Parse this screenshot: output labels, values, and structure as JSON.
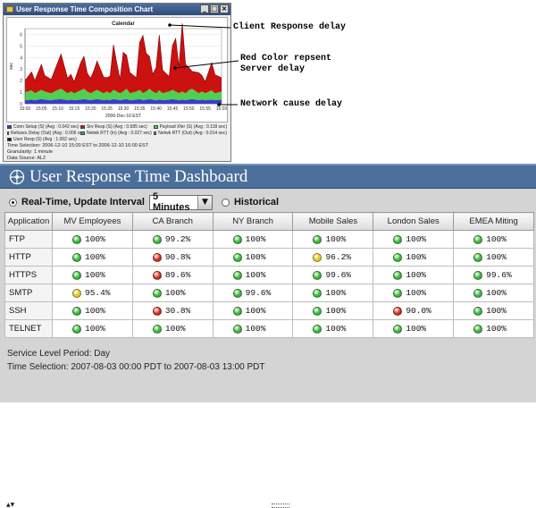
{
  "chart_window": {
    "title": "User Response Time Composition Chart",
    "controls": [
      "_",
      "□",
      "×"
    ],
    "legend": [
      {
        "label": "Conn Setup (S) (Avg : 0.042 sec)",
        "color": "#3a3ad6"
      },
      {
        "label": "Srv Resp (S) (Avg : 0.685 sec)",
        "color": "#cc1111"
      },
      {
        "label": "Payload Xfer (S) (Avg : 0.118 sec)",
        "color": "#4fd04f"
      },
      {
        "label": "Refuses Delay (Out) (Avg : 0.006 sec)",
        "color": "#8a5a2a"
      },
      {
        "label": "Netwk RTT (In) (Avg : 0.027 sec)",
        "color": "#2aa0a0"
      },
      {
        "label": "Netwk RTT (Out) (Avg : 0.014 sec)",
        "color": "#d050d0"
      },
      {
        "label": "User Resp (S) (Avg : 1.002 sec)",
        "color": "#222222"
      }
    ],
    "footer": [
      "Time Selection: 2006-12-10 15:00 EST to 2006-12-10 16:00 EST",
      "Granularity: 1 minute",
      "Data Source: AL2"
    ]
  },
  "chart_data": {
    "type": "area",
    "title": "Calendar",
    "xlabel": "2006-Dec-10 EST",
    "ylabel": "sec",
    "x_ticks": [
      "15:00",
      "15:05",
      "15:10",
      "15:15",
      "15:20",
      "15:25",
      "15:30",
      "15:35",
      "15:40",
      "15:45",
      "15:50",
      "15:55",
      "16:00"
    ],
    "y_ticks": [
      "0",
      "1",
      "2",
      "3",
      "4",
      "5",
      "6"
    ],
    "ylim": [
      0,
      6.5
    ],
    "x_minutes": [
      0,
      2,
      3,
      5,
      6,
      8,
      9,
      11,
      13,
      14,
      15,
      17,
      18,
      19,
      20,
      21,
      22,
      24,
      25,
      26,
      27,
      28,
      29,
      30,
      31,
      32,
      34,
      35,
      36,
      37,
      38,
      39,
      40,
      41,
      42,
      44,
      45,
      46,
      47,
      48,
      49,
      50,
      51,
      53,
      54,
      55,
      57,
      58,
      60
    ],
    "series": [
      {
        "name": "Netwk RTT",
        "color": "#3a3ad6",
        "values": [
          0.3,
          0.35,
          0.3,
          0.4,
          0.35,
          0.3,
          0.35,
          0.4,
          0.3,
          0.35,
          0.3,
          0.35,
          0.4,
          0.35,
          0.3,
          0.35,
          0.4,
          0.3,
          0.35,
          0.3,
          0.4,
          0.35,
          0.3,
          0.35,
          0.4,
          0.3,
          0.35,
          0.4,
          0.3,
          0.35,
          0.4,
          0.35,
          0.3,
          0.35,
          0.3,
          0.35,
          0.4,
          0.35,
          0.3,
          0.35,
          0.3,
          0.35,
          0.4,
          0.3,
          0.35,
          0.3,
          0.35,
          0.3,
          0.35
        ]
      },
      {
        "name": "Payload Xfer",
        "color": "#4fd04f",
        "values": [
          0.7,
          0.8,
          0.6,
          0.8,
          0.7,
          0.6,
          0.7,
          0.9,
          0.6,
          0.7,
          0.6,
          0.8,
          0.9,
          0.7,
          0.6,
          0.7,
          0.8,
          0.6,
          0.7,
          0.6,
          0.8,
          0.7,
          0.6,
          0.7,
          0.9,
          0.6,
          0.7,
          0.8,
          0.6,
          0.7,
          0.9,
          0.7,
          0.6,
          0.8,
          0.6,
          0.7,
          0.8,
          0.7,
          0.6,
          0.7,
          0.6,
          0.8,
          0.9,
          0.6,
          0.7,
          0.6,
          0.8,
          0.6,
          0.7
        ]
      },
      {
        "name": "User Resp",
        "color": "#cc1111",
        "values": [
          1.0,
          1.6,
          1.1,
          2.2,
          1.4,
          1.2,
          1.8,
          3.0,
          1.3,
          1.5,
          1.0,
          2.4,
          2.8,
          1.6,
          1.3,
          1.8,
          2.5,
          1.4,
          1.2,
          1.5,
          3.9,
          2.5,
          1.2,
          3.4,
          2.9,
          1.8,
          1.2,
          4.1,
          5.0,
          3.3,
          2.8,
          1.5,
          2.2,
          4.8,
          2.0,
          1.3,
          3.8,
          4.6,
          2.3,
          5.9,
          2.5,
          2.0,
          1.5,
          1.8,
          1.4,
          1.0,
          2.4,
          1.6,
          1.2
        ]
      }
    ]
  },
  "annotations": {
    "client": "Client Response delay",
    "server": "Red Color repsent\nServer delay",
    "network": "Network cause delay"
  },
  "dashboard": {
    "title": "User Response Time Dashboard",
    "realtime_label": "Real-Time,  Update Interval",
    "interval": "5 Minutes",
    "historical_label": "Historical",
    "columns": [
      "Application",
      "MV Employees",
      "CA Branch",
      "NY Branch",
      "Mobile Sales",
      "London Sales",
      "EMEA Miting"
    ],
    "rows": [
      {
        "app": "FTP",
        "cells": [
          {
            "v": "100%",
            "s": "green"
          },
          {
            "v": "99.2%",
            "s": "green"
          },
          {
            "v": "100%",
            "s": "green"
          },
          {
            "v": "100%",
            "s": "green"
          },
          {
            "v": "100%",
            "s": "green"
          },
          {
            "v": "100%",
            "s": "green"
          }
        ]
      },
      {
        "app": "HTTP",
        "cells": [
          {
            "v": "100%",
            "s": "green"
          },
          {
            "v": "90.8%",
            "s": "red"
          },
          {
            "v": "100%",
            "s": "green"
          },
          {
            "v": "96.2%",
            "s": "yellow"
          },
          {
            "v": "100%",
            "s": "green"
          },
          {
            "v": "100%",
            "s": "green"
          }
        ]
      },
      {
        "app": "HTTPS",
        "cells": [
          {
            "v": "100%",
            "s": "green"
          },
          {
            "v": "89.6%",
            "s": "red"
          },
          {
            "v": "100%",
            "s": "green"
          },
          {
            "v": "99.6%",
            "s": "green"
          },
          {
            "v": "100%",
            "s": "green"
          },
          {
            "v": "99.6%",
            "s": "green"
          }
        ]
      },
      {
        "app": "SMTP",
        "cells": [
          {
            "v": "95.4%",
            "s": "yellow"
          },
          {
            "v": "100%",
            "s": "green"
          },
          {
            "v": "99.6%",
            "s": "green"
          },
          {
            "v": "100%",
            "s": "green"
          },
          {
            "v": "100%",
            "s": "green"
          },
          {
            "v": "100%",
            "s": "green"
          }
        ]
      },
      {
        "app": "SSH",
        "cells": [
          {
            "v": "100%",
            "s": "green"
          },
          {
            "v": "30.8%",
            "s": "red"
          },
          {
            "v": "100%",
            "s": "green"
          },
          {
            "v": "100%",
            "s": "green"
          },
          {
            "v": "90.0%",
            "s": "red"
          },
          {
            "v": "100%",
            "s": "green"
          }
        ]
      },
      {
        "app": "TELNET",
        "cells": [
          {
            "v": "100%",
            "s": "green"
          },
          {
            "v": "100%",
            "s": "green"
          },
          {
            "v": "100%",
            "s": "green"
          },
          {
            "v": "100%",
            "s": "green"
          },
          {
            "v": "100%",
            "s": "green"
          },
          {
            "v": "100%",
            "s": "green"
          }
        ]
      }
    ],
    "status_colors": {
      "green": "#37b837",
      "red": "#d62a1a",
      "yellow": "#e6c61c"
    },
    "splitter_arrows": "▲▼",
    "service_level": "Service Level Period: Day",
    "time_selection": "Time Selection: 2007-08-03 00:00 PDT to 2007-08-03 13:00 PDT"
  }
}
